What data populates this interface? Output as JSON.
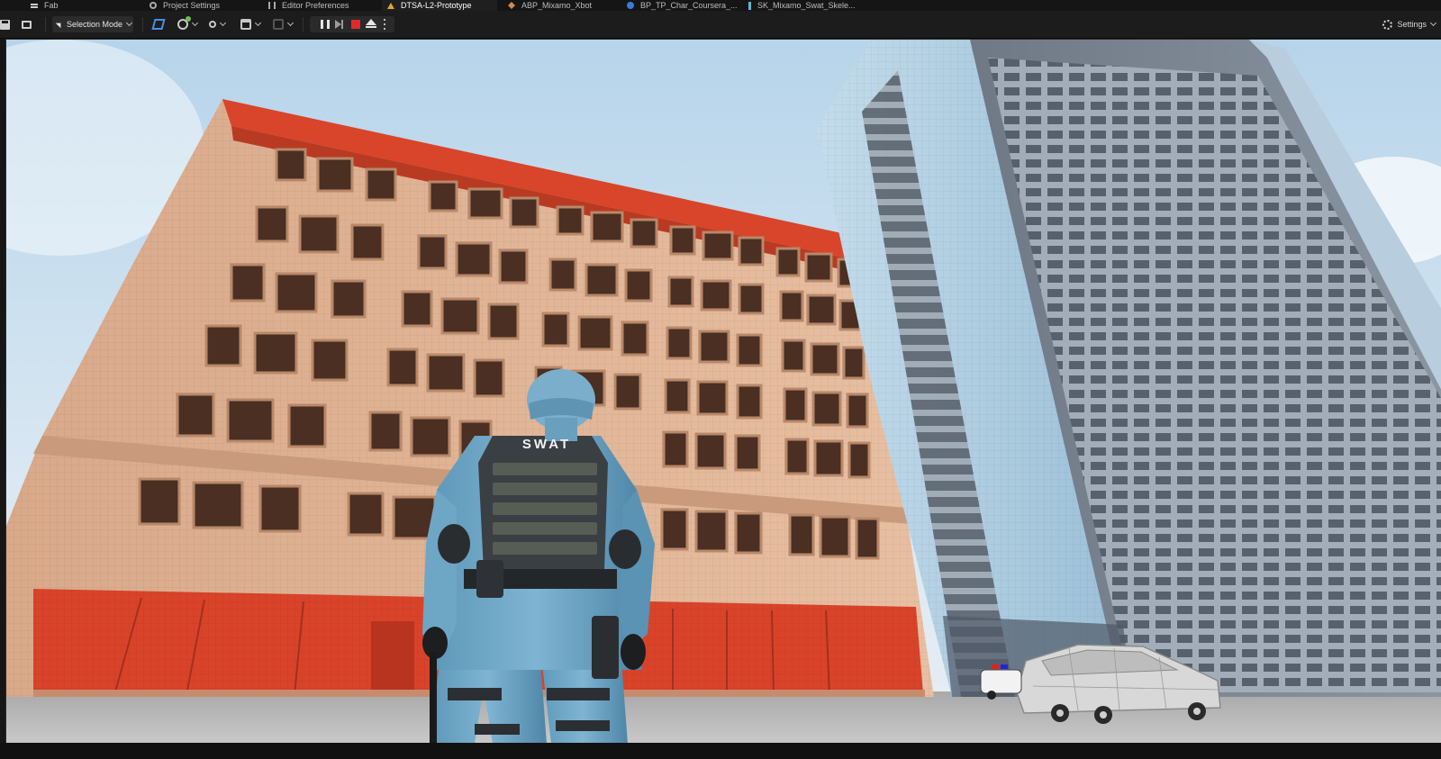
{
  "tabs": [
    {
      "label": "Fab",
      "icon": "fab-icon"
    },
    {
      "label": "Project Settings",
      "icon": "settings-gear-icon"
    },
    {
      "label": "Editor Preferences",
      "icon": "sliders-icon"
    },
    {
      "label": "DTSA-L2-Prototype",
      "icon": "level-icon",
      "active": true
    },
    {
      "label": "ABP_Mixamo_Xbot",
      "icon": "animation-blueprint-icon"
    },
    {
      "label": "BP_TP_Char_Coursera_...",
      "icon": "blueprint-character-icon"
    },
    {
      "label": "SK_Mixamo_Swat_Skele...",
      "icon": "skeleton-icon"
    }
  ],
  "toolbar": {
    "selection_mode": "Selection Mode",
    "settings_label": "Settings"
  },
  "viewport": {
    "vest_text": "SWAT"
  }
}
